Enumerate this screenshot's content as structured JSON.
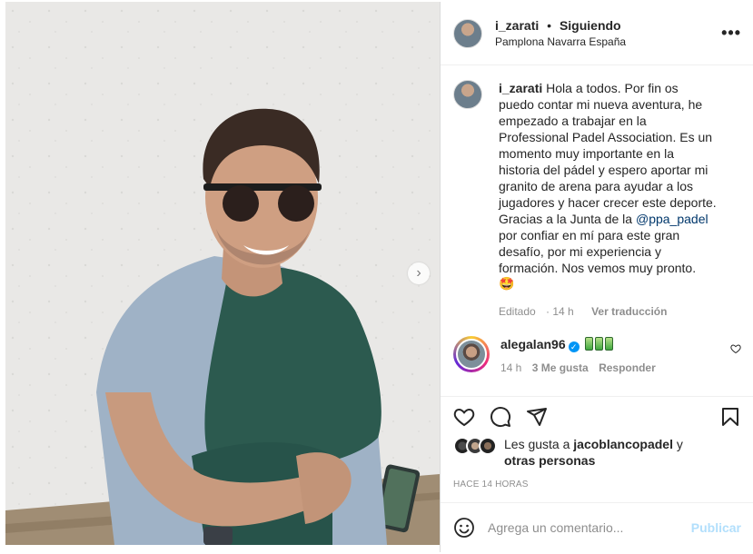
{
  "post": {
    "author": {
      "username": "i_zarati",
      "separator": "•",
      "follow_status": "Siguiendo",
      "location": "Pamplona Navarra España"
    },
    "more_icon": "more-horizontal-icon",
    "caption": {
      "username": "i_zarati",
      "text_before_mention": "Hola a todos. Por fin os puedo contar mi nueva aventura, he empezado a trabajar en la Professional Padel Association. Es un momento muy importante en la historia del pádel y espero aportar mi granito de arena para ayudar a los jugadores y hacer crecer este deporte. Gracias a la Junta de la ",
      "mention": "@ppa_padel",
      "text_after_mention": " por confiar en mí para este gran desafío, por mi experiencia y formación. Nos vemos muy pronto.",
      "emoji": "🤩",
      "edited_label": "Editado",
      "time": "14 h",
      "translate_label": "Ver traducción"
    },
    "comments": [
      {
        "username": "alegalan96",
        "verified": true,
        "time": "14 h",
        "likes_label": "3 Me gusta",
        "reply_label": "Responder",
        "battery_count": 3
      }
    ],
    "likes": {
      "prefix": "Les gusta a",
      "user": "jacoblancopadel",
      "connector": "y",
      "others": "otras personas"
    },
    "timestamp": "HACE 14 HORAS",
    "add_comment": {
      "placeholder": "Agrega un comentario...",
      "post_label": "Publicar"
    },
    "colors": {
      "link": "#00376b",
      "verified": "#0095f6",
      "publish_disabled": "#b2dffc",
      "muted": "#8e8e8e"
    }
  }
}
